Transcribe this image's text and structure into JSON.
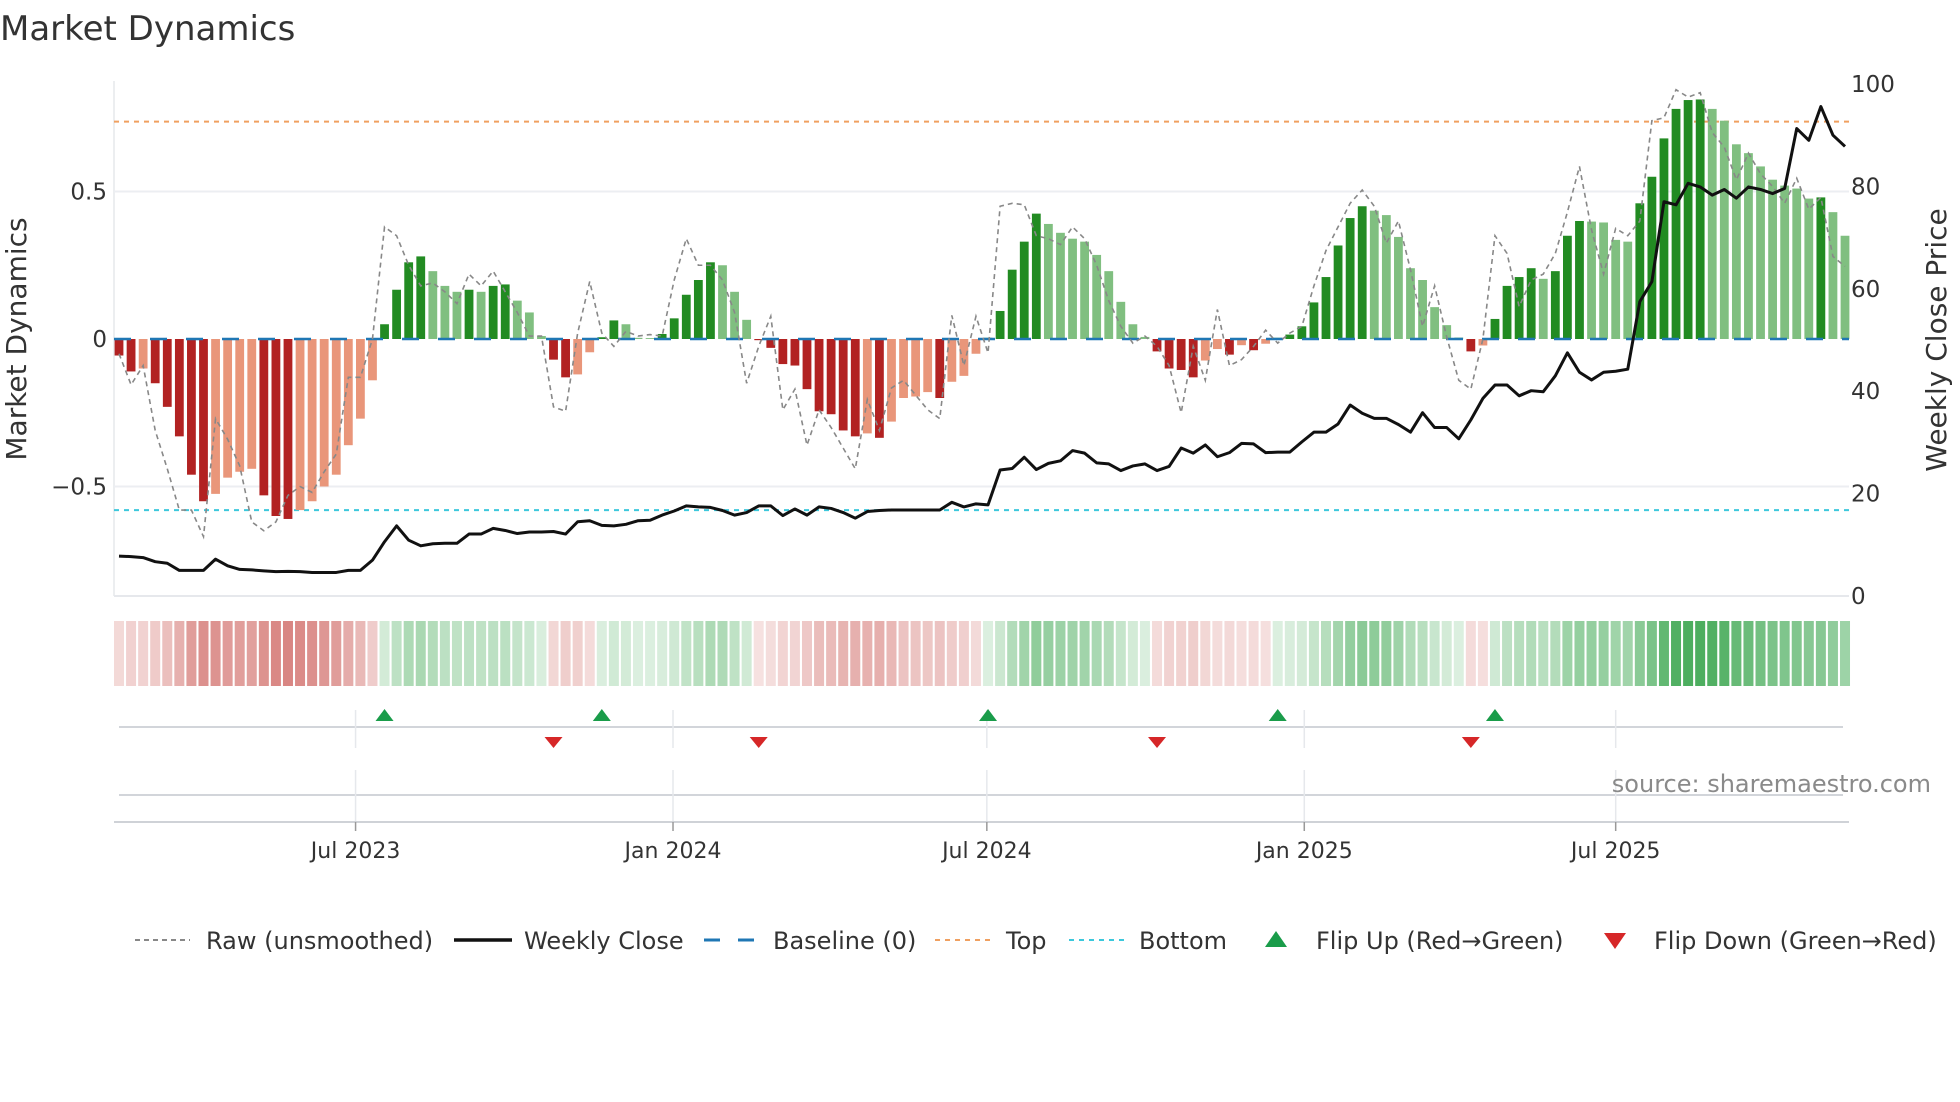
{
  "chart_data": {
    "type": "bar",
    "title": "Market Dynamics",
    "ylabel_left": "Market Dynamics",
    "ylabel_right": "Weekly Close Price",
    "ylim_left": [
      -0.87,
      0.87
    ],
    "ylim_right": [
      0,
      100
    ],
    "left_ticks": [
      {
        "value": 0.5,
        "label": "0.5"
      },
      {
        "value": 0,
        "label": "0"
      },
      {
        "value": -0.5,
        "label": "−0.5"
      }
    ],
    "right_ticks": [
      {
        "value": 100,
        "label": "100"
      },
      {
        "value": 80,
        "label": "80"
      },
      {
        "value": 60,
        "label": "60"
      },
      {
        "value": 40,
        "label": "40"
      },
      {
        "value": 20,
        "label": "20"
      },
      {
        "value": 0,
        "label": "0"
      }
    ],
    "x_ticks": [
      {
        "label": "Jul 2023",
        "week": 20.6
      },
      {
        "label": "Jan 2024",
        "week": 46.9
      },
      {
        "label": "Jul 2024",
        "week": 72.9
      },
      {
        "label": "Jan 2025",
        "week": 99.2
      },
      {
        "label": "Jul 2025",
        "week": 125.0
      }
    ],
    "levels": {
      "top": 0.737,
      "bottom": -0.58,
      "baseline": 0
    },
    "series": [
      {
        "name": "Market Dynamics",
        "kind": "bar",
        "values": [
          -0.056,
          -0.11,
          -0.1,
          -0.15,
          -0.23,
          -0.33,
          -0.46,
          -0.55,
          -0.525,
          -0.47,
          -0.45,
          -0.44,
          -0.53,
          -0.6,
          -0.61,
          -0.58,
          -0.55,
          -0.5,
          -0.46,
          -0.36,
          -0.27,
          -0.14,
          0.05,
          0.167,
          0.26,
          0.28,
          0.23,
          0.18,
          0.16,
          0.167,
          0.16,
          0.18,
          0.185,
          0.13,
          0.09,
          0.01,
          -0.07,
          -0.13,
          -0.12,
          -0.045,
          0.006,
          0.063,
          0.05,
          0.004,
          0.003,
          0.017,
          0.07,
          0.15,
          0.2,
          0.26,
          0.25,
          0.16,
          0.065,
          -0.004,
          -0.03,
          -0.085,
          -0.09,
          -0.17,
          -0.245,
          -0.255,
          -0.31,
          -0.33,
          -0.32,
          -0.335,
          -0.28,
          -0.2,
          -0.195,
          -0.18,
          -0.2,
          -0.145,
          -0.125,
          -0.05,
          0.004,
          0.095,
          0.235,
          0.33,
          0.425,
          0.39,
          0.36,
          0.34,
          0.33,
          0.285,
          0.23,
          0.126,
          0.05,
          0.007,
          -0.042,
          -0.1,
          -0.105,
          -0.13,
          -0.073,
          -0.034,
          -0.053,
          -0.021,
          -0.038,
          -0.016,
          0.004,
          0.015,
          0.043,
          0.124,
          0.21,
          0.317,
          0.41,
          0.45,
          0.435,
          0.42,
          0.346,
          0.24,
          0.2,
          0.108,
          0.047,
          0.005,
          -0.042,
          -0.022,
          0.068,
          0.18,
          0.21,
          0.24,
          0.204,
          0.23,
          0.35,
          0.4,
          0.398,
          0.395,
          0.336,
          0.33,
          0.46,
          0.55,
          0.68,
          0.78,
          0.81,
          0.812,
          0.78,
          0.74,
          0.66,
          0.63,
          0.585,
          0.54,
          0.52,
          0.51,
          0.476,
          0.48,
          0.43,
          0.35
        ]
      },
      {
        "name": "Raw (unsmoothed)",
        "kind": "line",
        "values": [
          -0.05,
          -0.155,
          -0.09,
          -0.31,
          -0.44,
          -0.58,
          -0.58,
          -0.67,
          -0.27,
          -0.34,
          -0.43,
          -0.62,
          -0.65,
          -0.62,
          -0.53,
          -0.5,
          -0.52,
          -0.45,
          -0.39,
          -0.13,
          -0.13,
          0.0,
          0.38,
          0.35,
          0.25,
          0.18,
          0.19,
          0.16,
          0.12,
          0.22,
          0.18,
          0.23,
          0.16,
          0.09,
          0.01,
          0.01,
          -0.23,
          -0.245,
          0.02,
          0.195,
          0.02,
          -0.025,
          0.026,
          0.01,
          0.015,
          0.01,
          0.2,
          0.34,
          0.25,
          0.25,
          0.2,
          0.09,
          -0.15,
          -0.025,
          0.077,
          -0.24,
          -0.17,
          -0.36,
          -0.24,
          -0.3,
          -0.37,
          -0.44,
          -0.205,
          -0.31,
          -0.166,
          -0.14,
          -0.19,
          -0.24,
          -0.27,
          0.08,
          -0.09,
          0.077,
          -0.047,
          0.45,
          0.46,
          0.455,
          0.35,
          0.34,
          0.32,
          0.38,
          0.34,
          0.25,
          0.13,
          0.043,
          -0.014,
          0.01,
          -0.025,
          -0.09,
          -0.25,
          -0.025,
          -0.14,
          0.1,
          -0.09,
          -0.07,
          -0.025,
          0.03,
          -0.014,
          0.02,
          0.043,
          0.18,
          0.3,
          0.38,
          0.46,
          0.505,
          0.45,
          0.325,
          0.4,
          0.235,
          0.043,
          0.18,
          0.007,
          -0.14,
          -0.17,
          0.0,
          0.35,
          0.29,
          0.11,
          0.2,
          0.22,
          0.29,
          0.43,
          0.585,
          0.37,
          0.22,
          0.375,
          0.35,
          0.4,
          0.74,
          0.75,
          0.845,
          0.82,
          0.835,
          0.7,
          0.65,
          0.54,
          0.63,
          0.56,
          0.517,
          0.46,
          0.545,
          0.44,
          0.48,
          0.28,
          0.246
        ]
      },
      {
        "name": "Weekly Close",
        "kind": "line",
        "axis": "right",
        "values": [
          7.8,
          7.7,
          7.5,
          6.7,
          6.4,
          5.0,
          5.0,
          5.0,
          7.2,
          5.9,
          5.2,
          5.1,
          4.9,
          4.75,
          4.8,
          4.75,
          4.6,
          4.6,
          4.6,
          5.0,
          5.0,
          7.0,
          10.6,
          13.7,
          10.9,
          9.8,
          10.2,
          10.3,
          10.3,
          12.1,
          12.1,
          13.2,
          12.8,
          12.2,
          12.5,
          12.5,
          12.6,
          12.1,
          14.5,
          14.7,
          13.8,
          13.7,
          14.0,
          14.7,
          14.8,
          15.8,
          16.6,
          17.6,
          17.4,
          17.3,
          16.7,
          15.8,
          16.3,
          17.6,
          17.6,
          15.7,
          17.0,
          15.8,
          17.4,
          17.1,
          16.3,
          15.2,
          16.5,
          16.7,
          16.8,
          16.8,
          16.8,
          16.8,
          16.8,
          18.3,
          17.4,
          18.0,
          17.8,
          24.6,
          24.9,
          27.1,
          24.7,
          25.9,
          26.4,
          28.4,
          27.9,
          26.0,
          25.8,
          24.5,
          25.4,
          25.8,
          24.5,
          25.3,
          28.9,
          27.9,
          29.5,
          27.2,
          28.0,
          29.8,
          29.7,
          28.0,
          28.1,
          28.1,
          30.1,
          32.0,
          32.0,
          33.6,
          37.3,
          35.7,
          34.7,
          34.7,
          33.5,
          32.0,
          35.8,
          32.9,
          32.9,
          30.7,
          34.4,
          38.6,
          41.2,
          41.2,
          39.1,
          40.1,
          39.9,
          43.0,
          47.5,
          43.7,
          42.2,
          43.7,
          43.9,
          44.3,
          57.5,
          61.4,
          77.0,
          76.4,
          80.6,
          79.9,
          78.3,
          79.4,
          77.7,
          79.9,
          79.4,
          78.6,
          79.6,
          91.3,
          89.0,
          95.6,
          90.0,
          87.8
        ]
      }
    ],
    "flips_up_week": [
      23,
      41,
      73,
      97,
      115
    ],
    "flips_down_week": [
      37,
      54,
      87,
      113
    ],
    "legend": {
      "placement": "bottom",
      "items": [
        {
          "key": "raw",
          "label": "Raw (unsmoothed)"
        },
        {
          "key": "close",
          "label": "Weekly Close"
        },
        {
          "key": "baseline",
          "label": "Baseline (0)"
        },
        {
          "key": "top",
          "label": "Top"
        },
        {
          "key": "bottom",
          "label": "Bottom"
        },
        {
          "key": "flip_up",
          "label": "Flip Up (Red→Green)"
        },
        {
          "key": "flip_down",
          "label": "Flip Down (Green→Red)"
        }
      ]
    },
    "colors": {
      "bar_pos_strong": "#228b22",
      "bar_pos_weak": "#80bf80",
      "bar_neg_strong": "#b22222",
      "bar_neg_weak": "#e9967a",
      "raw": "#888888",
      "close": "#111111",
      "baseline": "#1f77b4",
      "top": "#f0a060",
      "bottom": "#3cc8dc",
      "flip_up": "#1a9c4a",
      "flip_down": "#d62728",
      "heat_pos": "46,160,67",
      "heat_neg": "200,80,75"
    },
    "source": "source: sharemaestro.com"
  }
}
